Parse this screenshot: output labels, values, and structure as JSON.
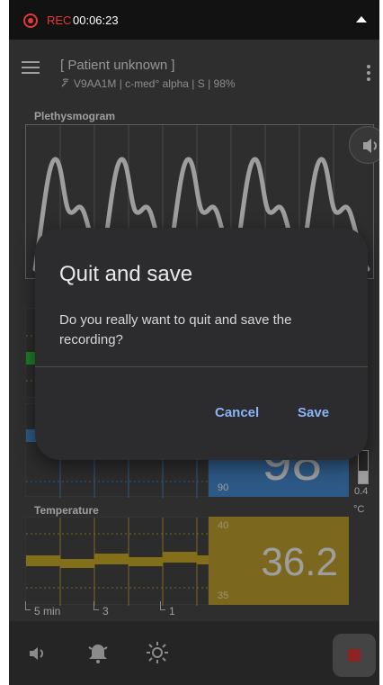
{
  "status": {
    "rec_label": "REC",
    "rec_time": "00:06:23"
  },
  "header": {
    "patient": "[ Patient unknown ]",
    "device": "V9AA1M | c-med° alpha | S | 98%"
  },
  "plethysmogram": {
    "label": "Plethysmogram"
  },
  "spo2": {
    "value_partial": "98",
    "low_limit": "90",
    "scale_value": "0.4"
  },
  "temperature": {
    "label": "Temperature",
    "unit": "°C",
    "value": "36.2",
    "high_limit": "40",
    "low_limit": "35",
    "time_marks": [
      "5 min",
      "3",
      "1"
    ]
  },
  "dialog": {
    "title": "Quit and save",
    "message": "Do you really want to quit and save the recording?",
    "cancel_label": "Cancel",
    "save_label": "Save"
  },
  "colors": {
    "accent": "#8ab4f8",
    "rec": "#e53935",
    "spo2_panel": "#4a90d9",
    "temp_panel": "#c9a632",
    "temp_trend": "#d4b32a"
  },
  "icons": {
    "bottom": [
      "volume-icon",
      "alarm-bell-icon",
      "brightness-icon",
      "stop-recording-icon"
    ]
  }
}
